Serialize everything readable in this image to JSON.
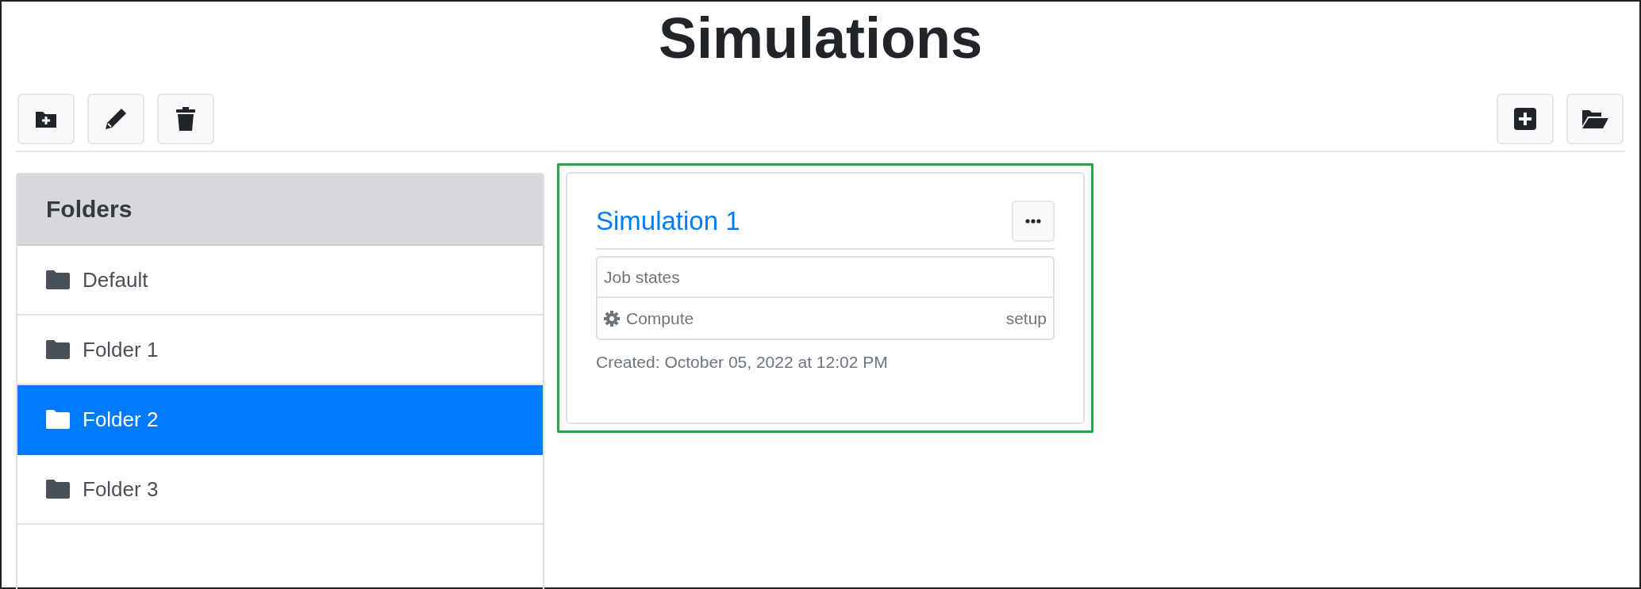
{
  "page": {
    "title": "Simulations"
  },
  "toolbar": {
    "left": [
      {
        "kind": "folder-plus"
      },
      {
        "kind": "pencil"
      },
      {
        "kind": "trash"
      }
    ],
    "right": [
      {
        "kind": "plus-square"
      },
      {
        "kind": "folder-open"
      }
    ]
  },
  "sidebar": {
    "header": "Folders",
    "items": [
      {
        "label": "Default",
        "selected": false
      },
      {
        "label": "Folder 1",
        "selected": false
      },
      {
        "label": "Folder 2",
        "selected": true
      },
      {
        "label": "Folder 3",
        "selected": false
      }
    ]
  },
  "simulations": [
    {
      "title": "Simulation 1",
      "highlighted": true,
      "job_states": {
        "header": "Job states",
        "rows": [
          {
            "name": "Compute",
            "state": "setup"
          }
        ]
      },
      "created": "Created: October 05, 2022 at 12:02 PM"
    }
  ]
}
